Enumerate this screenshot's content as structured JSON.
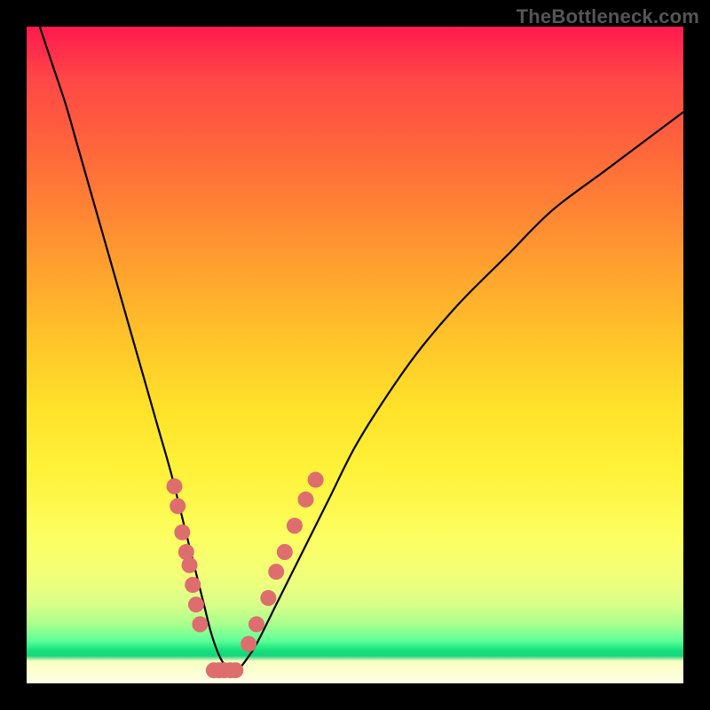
{
  "watermark": "TheBottleneck.com",
  "chart_data": {
    "type": "line",
    "title": "",
    "xlabel": "",
    "ylabel": "",
    "xlim": [
      0,
      100
    ],
    "ylim": [
      0,
      100
    ],
    "grid": false,
    "legend": false,
    "annotations": [],
    "series": [
      {
        "name": "bottleneck-curve",
        "x": [
          2,
          4,
          6,
          8,
          10,
          12,
          14,
          16,
          18,
          20,
          22,
          24,
          26,
          27,
          28,
          29,
          30,
          31,
          32,
          33,
          35,
          38,
          42,
          46,
          50,
          55,
          60,
          66,
          73,
          80,
          88,
          96,
          100
        ],
        "y": [
          100,
          94,
          88,
          81,
          74,
          67,
          60,
          53,
          46,
          39,
          32,
          24,
          16,
          12,
          8,
          5,
          3,
          2,
          2,
          3,
          6,
          12,
          20,
          28,
          36,
          44,
          51,
          58,
          65,
          72,
          78,
          84,
          87
        ]
      }
    ],
    "markers": {
      "name": "sample-points",
      "color": "#de6d6d",
      "radius_px": 9,
      "points": [
        {
          "x": 22.5,
          "y": 30
        },
        {
          "x": 23.0,
          "y": 27
        },
        {
          "x": 23.7,
          "y": 23
        },
        {
          "x": 24.3,
          "y": 20
        },
        {
          "x": 24.8,
          "y": 18
        },
        {
          "x": 25.3,
          "y": 15
        },
        {
          "x": 25.8,
          "y": 12
        },
        {
          "x": 26.4,
          "y": 9
        },
        {
          "x": 28.5,
          "y": 2
        },
        {
          "x": 29.3,
          "y": 2
        },
        {
          "x": 30.1,
          "y": 2
        },
        {
          "x": 31.0,
          "y": 2
        },
        {
          "x": 31.8,
          "y": 2
        },
        {
          "x": 33.8,
          "y": 6
        },
        {
          "x": 35.0,
          "y": 9
        },
        {
          "x": 36.8,
          "y": 13
        },
        {
          "x": 38.0,
          "y": 17
        },
        {
          "x": 39.3,
          "y": 20
        },
        {
          "x": 40.8,
          "y": 24
        },
        {
          "x": 42.5,
          "y": 28
        },
        {
          "x": 44.0,
          "y": 31
        }
      ]
    },
    "color_scale": {
      "orientation": "vertical",
      "low_color": "#14e07a",
      "mid_color": "#ffe22a",
      "high_color": "#ff1a4d",
      "low_value": 0,
      "high_value": 100
    }
  }
}
